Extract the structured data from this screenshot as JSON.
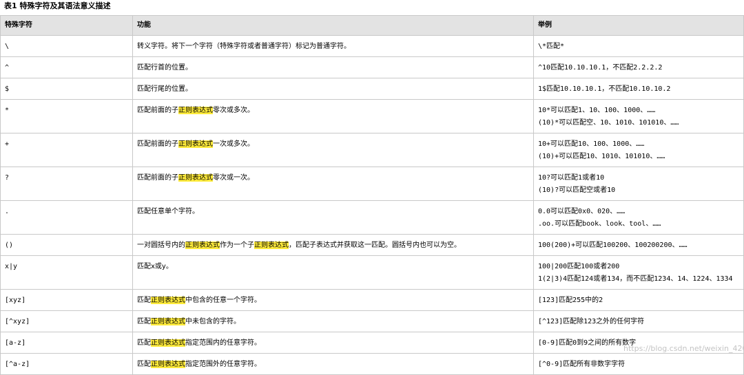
{
  "caption": "表1 特殊字符及其语法意义描述",
  "headers": [
    "特殊字符",
    "功能",
    "举例"
  ],
  "highlight_term": "正则表达式",
  "highlight_color": "#ffeb3b",
  "rows": [
    {
      "char": "\\",
      "func": "转义字符。将下一个字符（特殊字符或者普通字符）标记为普通字符。",
      "examples": [
        "\\*匹配*"
      ]
    },
    {
      "char": "^",
      "func": "匹配行首的位置。",
      "examples": [
        "^10匹配10.10.10.1，不匹配2.2.2.2"
      ]
    },
    {
      "char": "$",
      "func": "匹配行尾的位置。",
      "examples": [
        "1$匹配10.10.10.1，不匹配10.10.10.2"
      ]
    },
    {
      "char": "*",
      "func": "匹配前面的子正则表达式零次或多次。",
      "examples": [
        "10*可以匹配1、10、100、1000、……",
        "(10)*可以匹配空、10、1010、101010、……"
      ]
    },
    {
      "char": "+",
      "func": "匹配前面的子正则表达式一次或多次。",
      "examples": [
        "10+可以匹配10、100、1000、……",
        "(10)+可以匹配10、1010、101010、……"
      ]
    },
    {
      "char": "?",
      "func": "匹配前面的子正则表达式零次或一次。",
      "examples": [
        "10?可以匹配1或者10",
        "(10)?可以匹配空或者10"
      ]
    },
    {
      "char": ".",
      "func": "匹配任意单个字符。",
      "examples": [
        "0.0可以匹配0x0、020、……",
        ".oo.可以匹配book、look、tool、……"
      ]
    },
    {
      "char": "()",
      "func": "一对圆括号内的正则表达式作为一个子正则表达式，匹配子表达式并获取这一匹配。圆括号内也可以为空。",
      "examples": [
        "100(200)+可以匹配100200、100200200、……"
      ]
    },
    {
      "char": "x|y",
      "func": "匹配x或y。",
      "examples": [
        "100|200匹配100或者200",
        "1(2|3)4匹配124或者134，而不匹配1234、14、1224、1334"
      ]
    },
    {
      "char": "[xyz]",
      "func": "匹配正则表达式中包含的任意一个字符。",
      "examples": [
        "[123]匹配255中的2"
      ]
    },
    {
      "char": "[^xyz]",
      "func": "匹配正则表达式中未包含的字符。",
      "examples": [
        "[^123]匹配除123之外的任何字符"
      ]
    },
    {
      "char": "[a-z]",
      "func": "匹配正则表达式指定范围内的任意字符。",
      "examples": [
        "[0-9]匹配0到9之间的所有数字"
      ]
    },
    {
      "char": "[^a-z]",
      "func": "匹配正则表达式指定范围外的任意字符。",
      "examples": [
        "[^0-9]匹配所有非数字字符"
      ]
    }
  ],
  "watermark": "https://blog.csdn.net/weixin_42052506"
}
